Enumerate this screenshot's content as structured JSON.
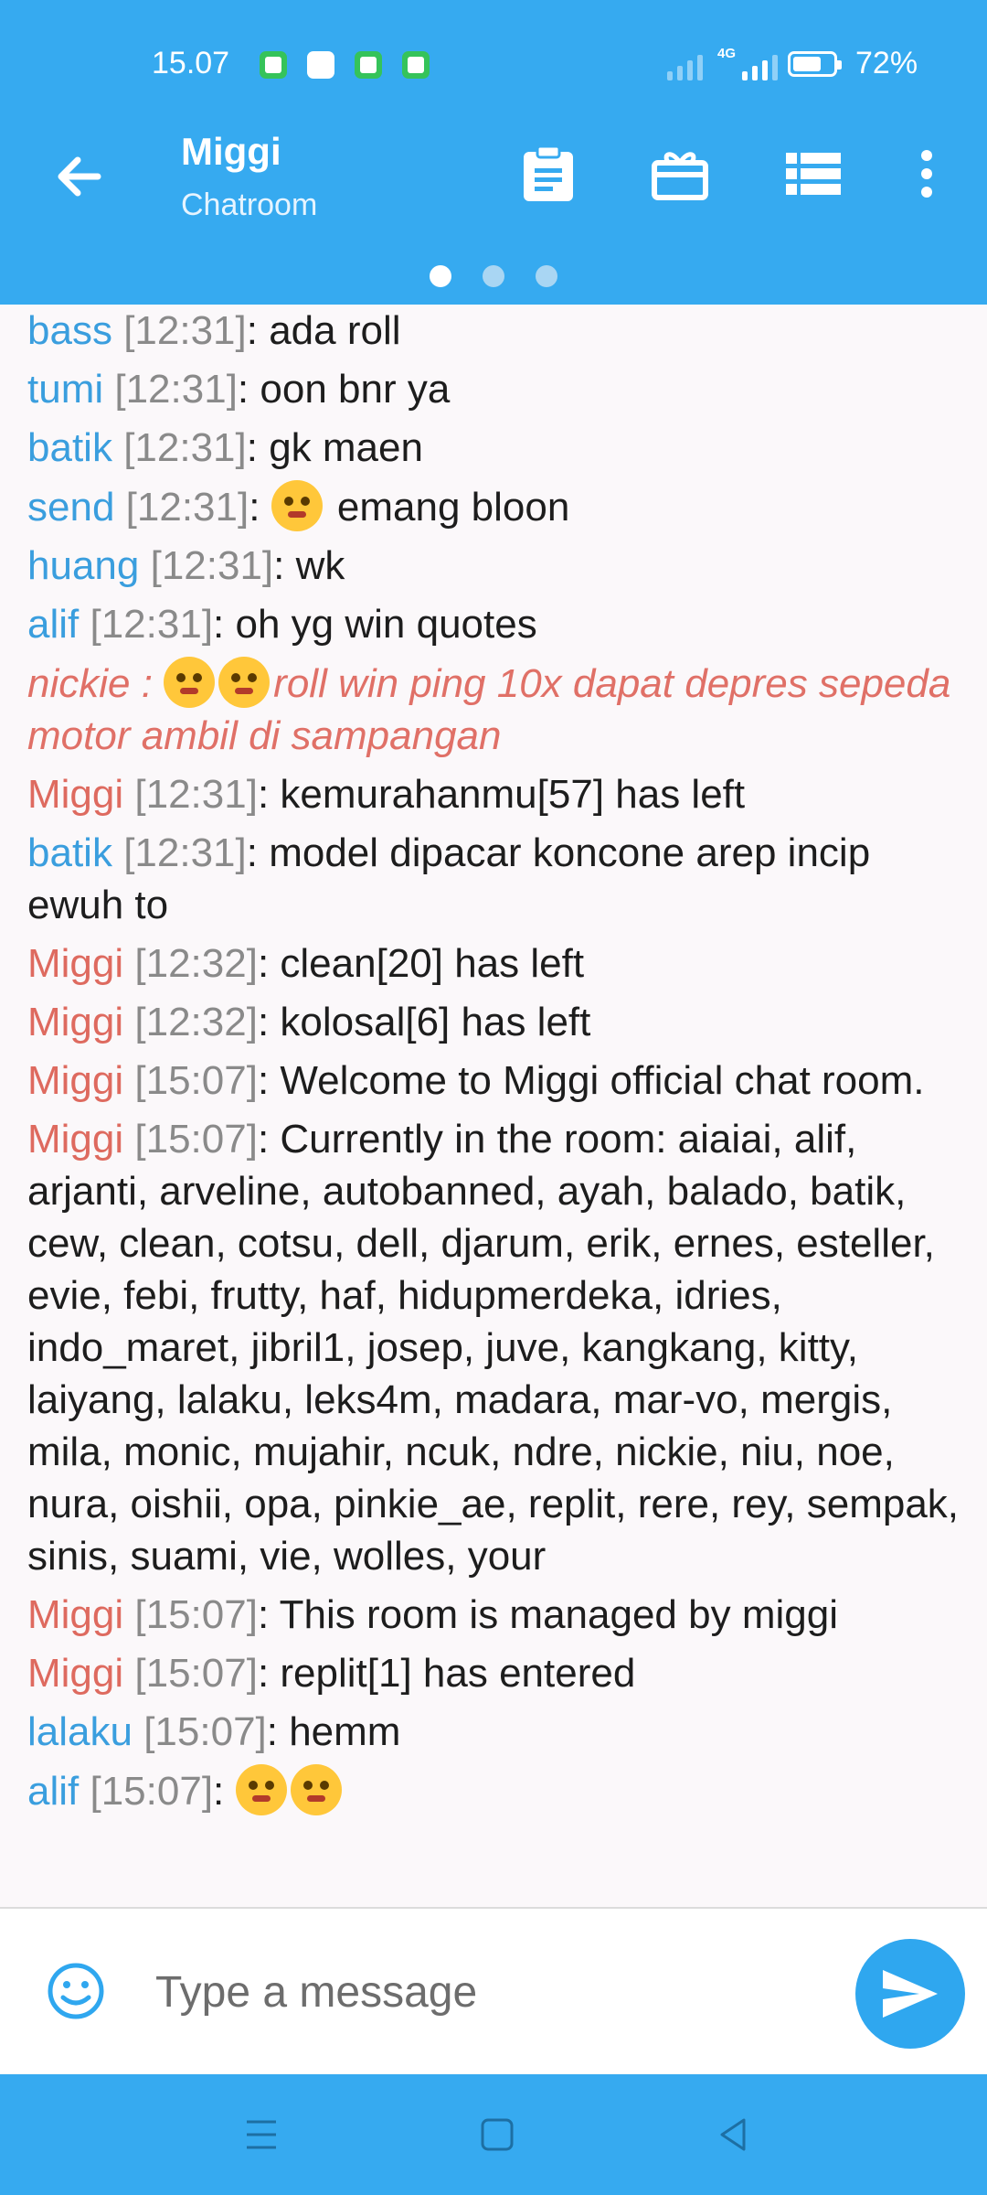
{
  "status_bar": {
    "time": "15.07",
    "network": "4G",
    "battery": "72%",
    "battery_level": 0.72
  },
  "header": {
    "title": "Miggi",
    "subtitle": "Chatroom",
    "page_indicator": {
      "count": 3,
      "active": 0
    }
  },
  "colors": {
    "header_bg": "#36aaf0",
    "nick_blue": "#3a9ede",
    "nick_red": "#de6a5f",
    "timestamp": "#8a8a8a"
  },
  "messages": [
    {
      "nick": "bass",
      "color": "blue",
      "time": "[12:31]",
      "text": ": ada roll"
    },
    {
      "nick": "tumi",
      "color": "blue",
      "time": "[12:31]",
      "text": ": oon bnr ya"
    },
    {
      "nick": "batik",
      "color": "blue",
      "time": "[12:31]",
      "text": ": gk maen"
    },
    {
      "nick": "send",
      "color": "blue",
      "time": "[12:31]",
      "text": ": emang bloon",
      "emoji": "unamused-face"
    },
    {
      "nick": "huang",
      "color": "blue",
      "time": "[12:31]",
      "text": ": wk"
    },
    {
      "nick": "alif",
      "color": "blue",
      "time": "[12:31]",
      "text": ": oh yg win quotes"
    },
    {
      "nick": "nickie",
      "style": "system-italic",
      "prefix": "nickie : ",
      "text": "roll win ping 10x dapat depres sepeda motor ambil di sampangan",
      "emoji_count": 2
    },
    {
      "nick": "Miggi",
      "color": "red",
      "time": "[12:31]",
      "text": ": kemurahanmu[57] has left"
    },
    {
      "nick": "batik",
      "color": "blue",
      "time": "[12:31]",
      "text": ": model dipacar koncone arep incip ewuh to"
    },
    {
      "nick": "Miggi",
      "color": "red",
      "time": "[12:32]",
      "text": ": clean[20] has left"
    },
    {
      "nick": "Miggi",
      "color": "red",
      "time": "[12:32]",
      "text": ": kolosal[6] has left"
    },
    {
      "nick": "Miggi",
      "color": "red",
      "time": "[15:07]",
      "text": ": Welcome to Miggi official chat room."
    },
    {
      "nick": "Miggi",
      "color": "red",
      "time": "[15:07]",
      "text": ": Currently in the room: aiaiai, alif, arjanti, arveline, autobanned, ayah, balado, batik, cew, clean, cotsu, dell, djarum, erik, ernes, esteller, evie, febi, frutty, haf, hidupmerdeka, idries, indo_maret, jibril1, josep, juve, kangkang, kitty, laiyang, lalaku, leks4m, madara, mar-vo, mergis, mila, monic, mujahir, ncuk, ndre, nickie, niu, noe, nura, oishii, opa, pinkie_ae, replit, rere, rey, sempak, sinis, suami, vie, wolles, your"
    },
    {
      "nick": "Miggi",
      "color": "red",
      "time": "[15:07]",
      "text": ": This room is managed by miggi"
    },
    {
      "nick": "Miggi",
      "color": "red",
      "time": "[15:07]",
      "text": ": replit[1] has entered"
    },
    {
      "nick": "lalaku",
      "color": "blue",
      "time": "[15:07]",
      "text": ": hemm"
    },
    {
      "nick": "alif",
      "color": "blue",
      "time": "[15:07]",
      "text": ": ",
      "emoji_count": 2
    }
  ],
  "composer": {
    "placeholder": "Type a message"
  },
  "icons": {
    "back": "arrow-left-icon",
    "clipboard": "clipboard-icon",
    "gift": "gift-icon",
    "list": "list-icon",
    "more": "more-vertical-icon",
    "emoji": "smiley-icon",
    "send": "send-icon"
  }
}
